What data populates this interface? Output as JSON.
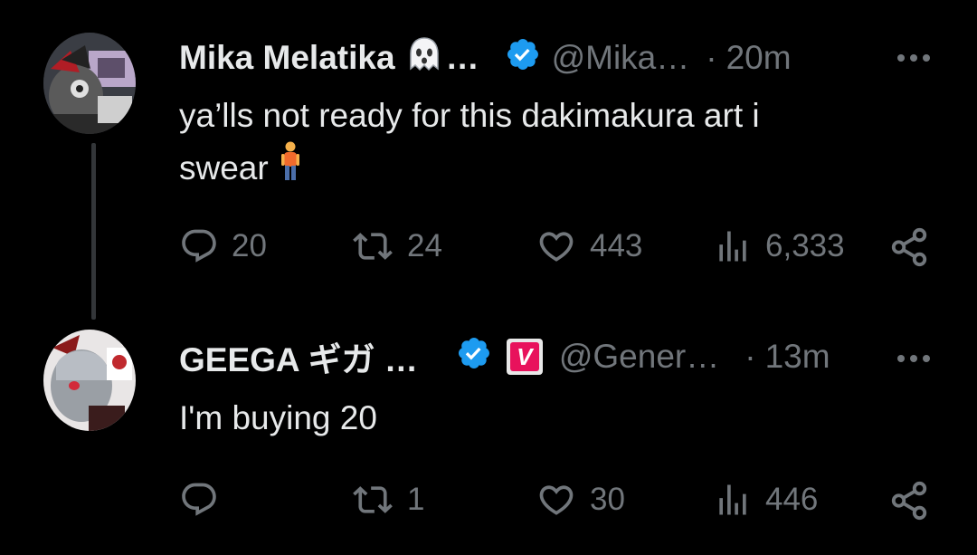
{
  "tweets": [
    {
      "name": "Mika Melatika",
      "name_suffix": "…",
      "handle": "@Mika…",
      "dot": "·",
      "time": "20m",
      "text_line1": "ya’lls not ready for this dakimakura art i",
      "text_line2": "swear",
      "stats": {
        "replies": "20",
        "reposts": "24",
        "likes": "443",
        "views": "6,333"
      }
    },
    {
      "name": "GEEGA ギガ …",
      "handle": "@Gener…",
      "dot": "·",
      "time": "13m",
      "badge_letter": "V",
      "text_line1": "I'm buying 20",
      "stats": {
        "replies": "",
        "reposts": "1",
        "likes": "30",
        "views": "446"
      }
    }
  ],
  "colors": {
    "background": "#000000",
    "text": "#e7e9ea",
    "muted": "#71767b",
    "verified": "#1d9bf0",
    "badge": "#e8125c",
    "thread_line": "#333639"
  },
  "icons": [
    "ghost-icon",
    "verified-icon",
    "more-icon",
    "reply-icon",
    "repost-icon",
    "like-icon",
    "views-icon",
    "share-icon",
    "person-standing-emoji"
  ]
}
